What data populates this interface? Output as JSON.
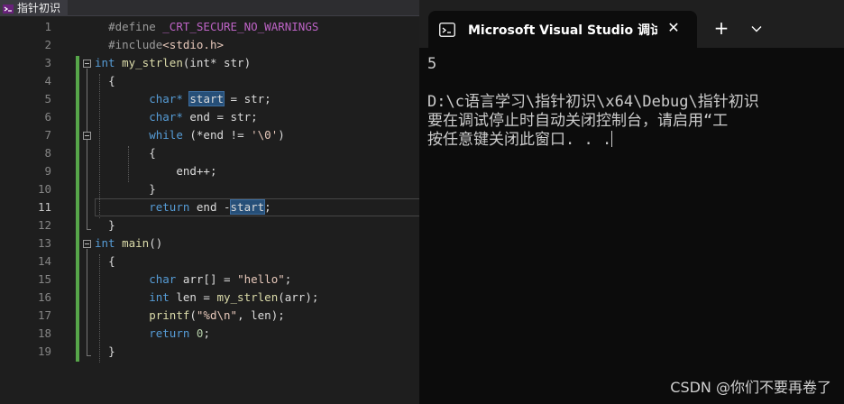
{
  "editor": {
    "tab_title": "指针初识",
    "line_numbers": [
      "1",
      "2",
      "3",
      "4",
      "5",
      "6",
      "7",
      "8",
      "9",
      "10",
      "11",
      "12",
      "13",
      "14",
      "15",
      "16",
      "17",
      "18",
      "19"
    ],
    "active_line": "11",
    "code": {
      "l1_directive": "#define",
      "l1_macro": "_CRT_SECURE_NO_WARNINGS",
      "l2_directive": "#include",
      "l2_header": "<stdio.h>",
      "l3_type": "int",
      "l3_func": "my_strlen",
      "l3_params": "(int* str)",
      "l4": "{",
      "l5_type": "char*",
      "l5_var": "start",
      "l5_rest": " = str;",
      "l6_type": "char*",
      "l6_rest": " end = str;",
      "l7_kw": "while",
      "l7_a": " (*end != ",
      "l7_str1": "'",
      "l7_esc": "\\0",
      "l7_str2": "'",
      "l7_b": ")",
      "l8": "{",
      "l9": "end++;",
      "l10": "}",
      "l11_kw": "return",
      "l11_a": " end -",
      "l11_var": "start",
      "l11_b": ";",
      "l12": "}",
      "l13_type": "int",
      "l13_func": "main",
      "l13_rest": "()",
      "l14": "{",
      "l15_type": "char",
      "l15_a": " arr[] = ",
      "l15_str": "\"hello\"",
      "l15_b": ";",
      "l16_type": "int",
      "l16_a": " len = ",
      "l16_func": "my_strlen",
      "l16_b": "(arr);",
      "l17_func": "printf",
      "l17_a": "(",
      "l17_str": "\"%d\\n\"",
      "l17_b": ", len);",
      "l18_kw": "return",
      "l18_num": " 0",
      "l18_b": ";",
      "l19": "}"
    }
  },
  "terminal": {
    "tab_title": "Microsoft Visual Studio 调试控",
    "close_glyph": "✕",
    "new_tab_glyph": "+",
    "output": [
      "5",
      "",
      "D:\\c语言学习\\指针初识\\x64\\Debug\\指针初识",
      "要在调试停止时自动关闭控制台，请启用“工",
      "按任意键关闭此窗口. . ."
    ]
  },
  "watermark": "CSDN @你们不要再卷了",
  "colors": {
    "keyword": "#569cd6",
    "function": "#dcdcaa",
    "string": "#e8c9bb",
    "macro": "#bd63c5",
    "change_bar": "#57a64a",
    "selection": "#264f78"
  },
  "icons": [
    "vs-file-icon",
    "terminal-cmd-icon",
    "close-icon",
    "plus-icon",
    "chevron-down-icon"
  ]
}
